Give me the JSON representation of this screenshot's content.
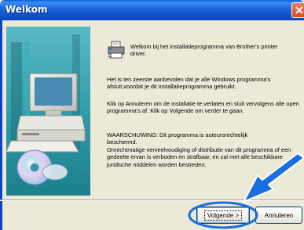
{
  "window": {
    "title": "Welkom",
    "close_icon": "close-icon"
  },
  "welcome": {
    "heading": "Welkom bij het installatieprogramma van Brother's printer driver.",
    "icon": "printer-icon"
  },
  "paragraphs": [
    "Het is ten zeerste aanbevolen dat je alle Windows programma's afsluit,voordat je dit installatieprogramma gebruikt.",
    "Klik op Annuleren om de installatie te verlaten en sluit vervolgens alle open programma's af. Klik op Volgende om verder te gaan.",
    "WAARSCHUWING: Dit programma is auteursrechtelijk beschermd.",
    "Onrechtmatige verveelvoudiging of distributie van dit programma of een gedeelte ervan is verboden en strafbaar, en zal met alle beschikbare juridische middelen worden bestreden."
  ],
  "buttons": {
    "next": "Volgende >",
    "cancel": "Annuleren"
  },
  "colors": {
    "titlebar": "#0d4fc9",
    "arrow": "#1a6fe0",
    "art_background": "#2e9aa6"
  }
}
